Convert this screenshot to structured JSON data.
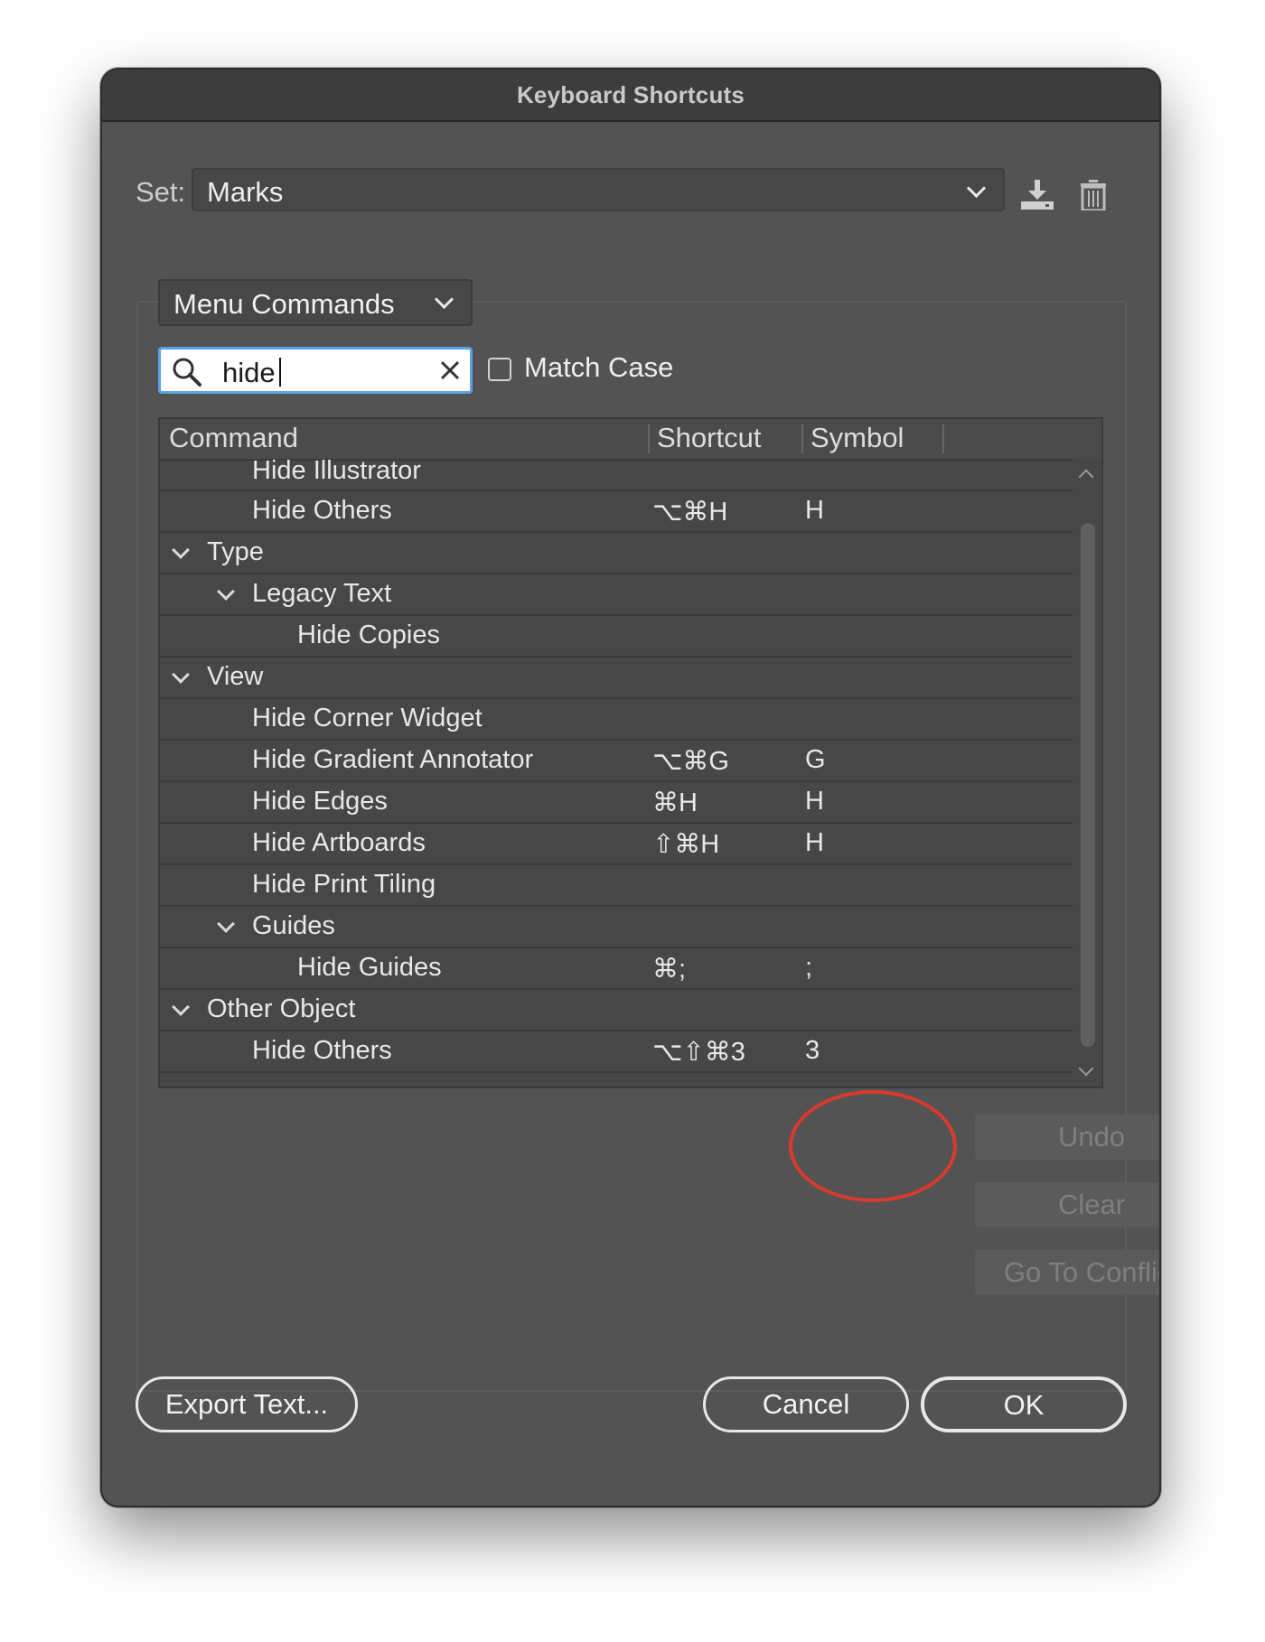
{
  "window": {
    "title": "Keyboard Shortcuts"
  },
  "set": {
    "label": "Set:",
    "value": "Marks"
  },
  "icons": {
    "save": "save-set-icon",
    "delete": "trash-icon",
    "search": "search-icon",
    "clear": "close-icon"
  },
  "menu": {
    "value": "Menu Commands"
  },
  "search": {
    "value": "hide"
  },
  "match_case": {
    "label": "Match Case",
    "checked": false
  },
  "table": {
    "headers": {
      "command": "Command",
      "shortcut": "Shortcut",
      "symbol": "Symbol"
    },
    "rows": [
      {
        "label": "Hide Illustrator",
        "shortcut": "",
        "symbol": ""
      },
      {
        "label": "Hide Others",
        "shortcut": "⌥⌘H",
        "symbol": "H"
      },
      {
        "label": "Type",
        "shortcut": "",
        "symbol": ""
      },
      {
        "label": "Legacy Text",
        "shortcut": "",
        "symbol": ""
      },
      {
        "label": "Hide Copies",
        "shortcut": "",
        "symbol": ""
      },
      {
        "label": "View",
        "shortcut": "",
        "symbol": ""
      },
      {
        "label": "Hide Corner Widget",
        "shortcut": "",
        "symbol": ""
      },
      {
        "label": "Hide Gradient Annotator",
        "shortcut": "⌥⌘G",
        "symbol": "G"
      },
      {
        "label": "Hide Edges",
        "shortcut": "⌘H",
        "symbol": "H"
      },
      {
        "label": "Hide Artboards",
        "shortcut": "⇧⌘H",
        "symbol": "H"
      },
      {
        "label": "Hide Print Tiling",
        "shortcut": "",
        "symbol": ""
      },
      {
        "label": "Guides",
        "shortcut": "",
        "symbol": ""
      },
      {
        "label": "Hide Guides",
        "shortcut": "⌘;",
        "symbol": ";"
      },
      {
        "label": "Other Object",
        "shortcut": "",
        "symbol": ""
      },
      {
        "label": "Hide Others",
        "shortcut": "⌥⇧⌘3",
        "symbol": "3"
      }
    ]
  },
  "buttons": {
    "undo": "Undo",
    "clear": "Clear",
    "go_to_conflict": "Go To Conflict",
    "export": "Export Text...",
    "cancel": "Cancel",
    "ok": "OK"
  },
  "colors": {
    "annotation": "#d83a2e",
    "focus": "#5aa0e8"
  }
}
